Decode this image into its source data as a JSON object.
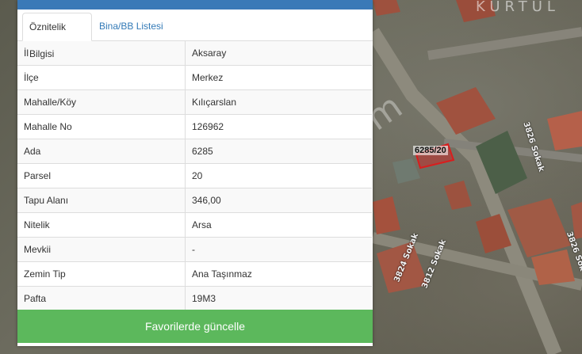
{
  "map": {
    "district_label": "KURTUL",
    "parcel_label": "6285/20",
    "watermark": "emlakjet.com",
    "street_labels": [
      "3826 Sokak",
      "3824 Sokak",
      "3812 Sokak",
      "3826 Sok"
    ]
  },
  "tabs": [
    {
      "label": "Öznitelik Bilgisi",
      "active": true
    },
    {
      "label": "Bina/BB Listesi",
      "active": false
    }
  ],
  "attributes": [
    {
      "key": "İl",
      "value": "Aksaray"
    },
    {
      "key": "İlçe",
      "value": "Merkez"
    },
    {
      "key": "Mahalle/Köy",
      "value": "Kılıçarslan"
    },
    {
      "key": "Mahalle No",
      "value": "126962"
    },
    {
      "key": "Ada",
      "value": "6285"
    },
    {
      "key": "Parsel",
      "value": "20"
    },
    {
      "key": "Tapu Alanı",
      "value": "346,00"
    },
    {
      "key": "Nitelik",
      "value": "Arsa"
    },
    {
      "key": "Mevkii",
      "value": "-"
    },
    {
      "key": "Zemin Tip",
      "value": "Ana Taşınmaz"
    },
    {
      "key": "Pafta",
      "value": "19M3"
    }
  ],
  "favorite_button_label": "Favorilerde güncelle",
  "colors": {
    "panel_header": "#3a79b7",
    "button": "#5cb85c",
    "tab_link": "#337ab7",
    "parcel_outline": "#d81e1e"
  }
}
